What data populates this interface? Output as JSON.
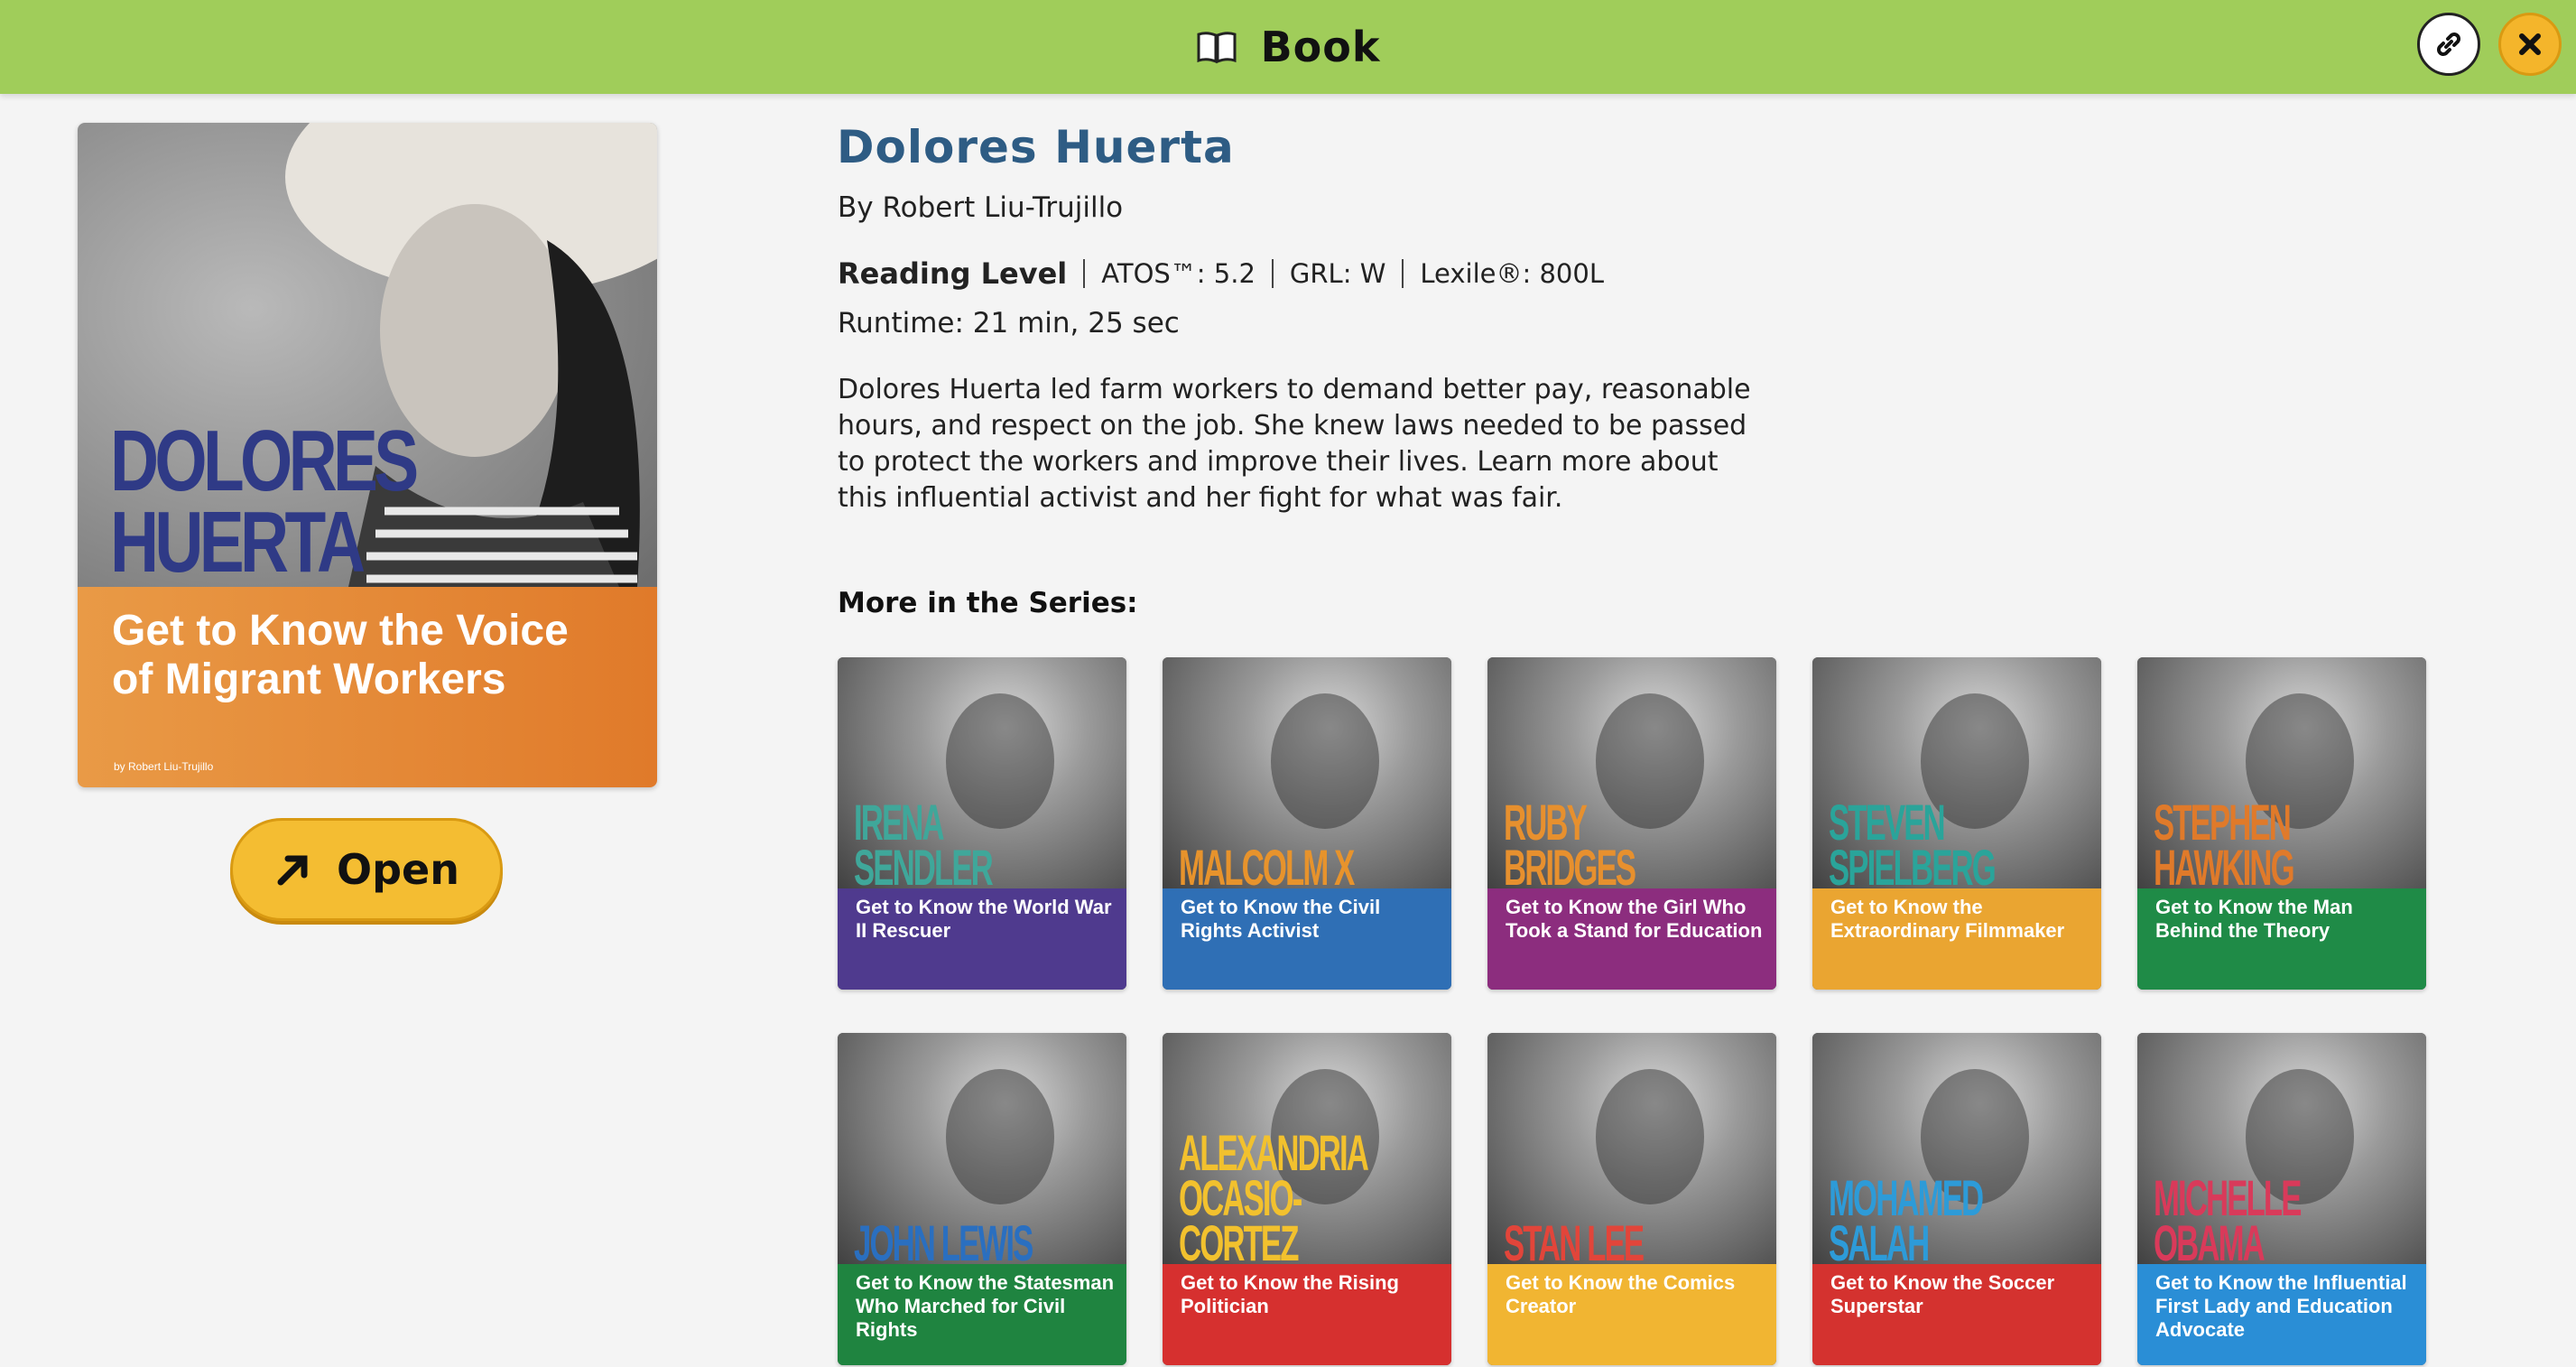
{
  "topbar": {
    "title": "Book",
    "icons": [
      "open-book-icon",
      "link-icon",
      "close-icon"
    ],
    "color": "#a0cd5a"
  },
  "cover": {
    "name": "DOLORES HUERTA",
    "subtitle": "Get to Know the Voice of Migrant Workers",
    "author": "by Robert Liu-Trujillo",
    "name_color": "#2f3a86",
    "band_color": "#e38a36"
  },
  "open_button": {
    "label": "Open",
    "icon": "arrow-up-right-icon",
    "color": "#f4bd32"
  },
  "details": {
    "title": "Dolores Huerta",
    "author": "By Robert Liu-Trujillo",
    "reading_level_label": "Reading Level",
    "atos": "ATOS™: 5.2",
    "grl": "GRL: W",
    "lexile": "Lexile®: 800L",
    "runtime": "Runtime: 21 min, 25 sec",
    "description": "Dolores Huerta led farm workers to demand better pay, reasonable hours, and respect on the job. She knew laws needed to be passed to protect the workers and improve their lives. Learn more about this influential activist and her fight for what was fair.",
    "title_color": "#2e5c84"
  },
  "series": {
    "heading": "More in the Series:",
    "books": [
      {
        "name": "IRENA SENDLER",
        "subtitle": "Get to Know the World War II Rescuer",
        "band_color": "#4f3a8e",
        "name_color": "#3fa79a"
      },
      {
        "name": "MALCOLM X",
        "subtitle": "Get to Know the Civil Rights Activist",
        "band_color": "#2f6fb5",
        "name_color": "#e7932c"
      },
      {
        "name": "RUBY BRIDGES",
        "subtitle": "Get to Know the Girl Who Took a Stand for Education",
        "band_color": "#8c2d7e",
        "name_color": "#e7902e"
      },
      {
        "name": "STEVEN SPIELBERG",
        "subtitle": "Get to Know the Extraordinary Filmmaker",
        "band_color": "#eaa531",
        "name_color": "#2aa49a"
      },
      {
        "name": "STEPHEN HAWKING",
        "subtitle": "Get to Know the Man Behind the Theory",
        "band_color": "#1f8b47",
        "name_color": "#e07a2a"
      },
      {
        "name": "JOHN LEWIS",
        "subtitle": "Get to Know the Statesman Who Marched for Civil Rights",
        "band_color": "#1f8440",
        "name_color": "#2a6fc0"
      },
      {
        "name": "ALEXANDRIA OCASIO-CORTEZ",
        "subtitle": "Get to Know the Rising Politician",
        "band_color": "#d6302f",
        "name_color": "#f2c12e"
      },
      {
        "name": "STAN LEE",
        "subtitle": "Get to Know the Comics Creator",
        "band_color": "#f1b532",
        "name_color": "#e2453a"
      },
      {
        "name": "MOHAMED SALAH",
        "subtitle": "Get to Know the Soccer Superstar",
        "band_color": "#d4322f",
        "name_color": "#2d9bd8"
      },
      {
        "name": "MICHELLE OBAMA",
        "subtitle": "Get to Know the Influential First Lady and Education Advocate",
        "band_color": "#2a8ed6",
        "name_color": "#d93a5a"
      }
    ]
  }
}
